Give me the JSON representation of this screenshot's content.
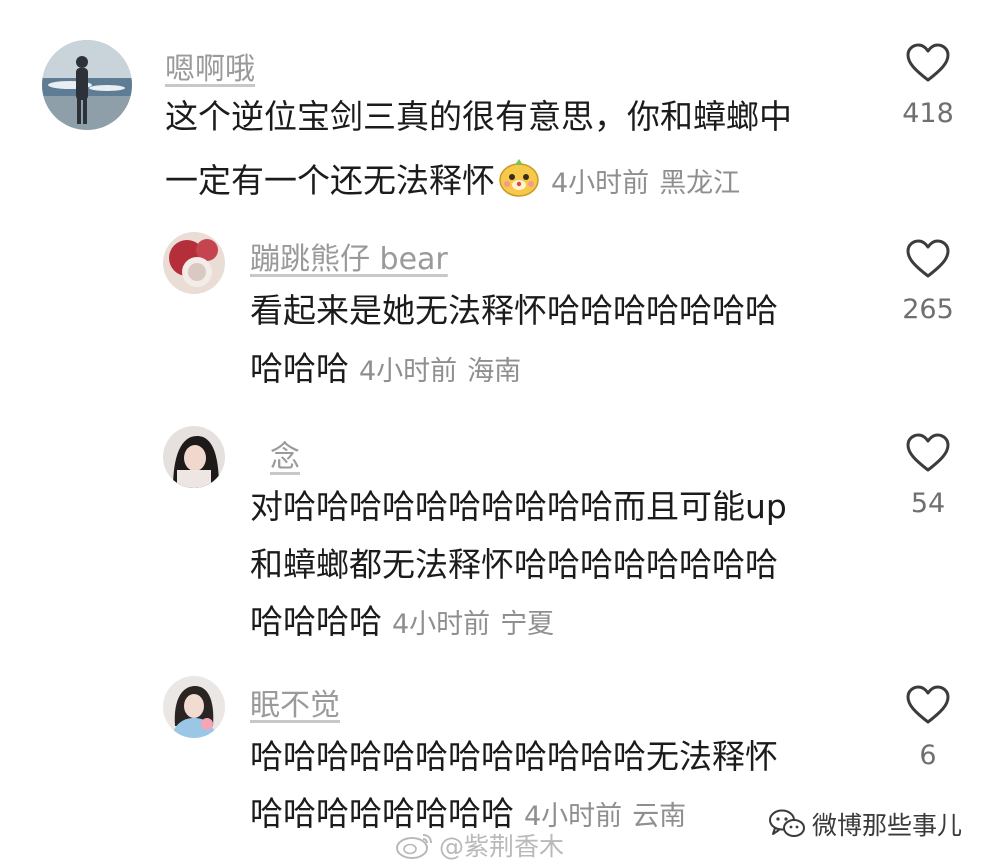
{
  "comments": [
    {
      "username": "嗯啊哦",
      "lines": [
        "这个逆位宝剑三真的很有意思，你和蟑螂中",
        "一定有一个还无法释怀"
      ],
      "has_emoji": true,
      "emoji_icon": "dog-face-emoji-icon",
      "time": "4小时前",
      "location": "黑龙江",
      "likes": "418"
    },
    {
      "username": "蹦跳熊仔 bear",
      "lines": [
        "看起来是她无法释怀哈哈哈哈哈哈哈",
        "哈哈哈"
      ],
      "time": "4小时前",
      "location": "海南",
      "likes": "265"
    },
    {
      "username": "念",
      "lines": [
        "对哈哈哈哈哈哈哈哈哈哈而且可能up",
        "和蟑螂都无法释怀哈哈哈哈哈哈哈哈",
        "哈哈哈哈"
      ],
      "time": "4小时前",
      "location": "宁夏",
      "likes": "54"
    },
    {
      "username": "眠不觉",
      "lines": [
        "哈哈哈哈哈哈哈哈哈哈哈哈无法释怀",
        "哈哈哈哈哈哈哈哈"
      ],
      "time": "4小时前",
      "location": "云南",
      "likes": "6"
    }
  ],
  "watermark": {
    "weibo_handle": "@紫荆香木",
    "wechat_account": "微博那些事儿"
  }
}
